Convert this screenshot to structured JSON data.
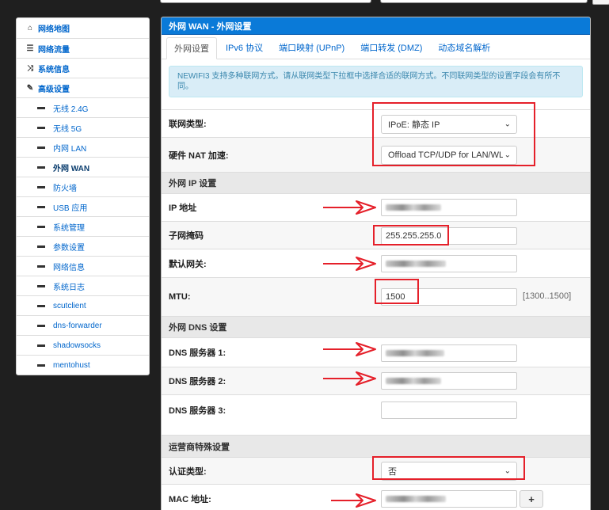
{
  "sidebar": {
    "items": [
      {
        "icon": "home-icon",
        "glyph": "⌂",
        "label": "网络地图",
        "type": "main"
      },
      {
        "icon": "list-icon",
        "glyph": "☰",
        "label": "网络流量",
        "type": "main"
      },
      {
        "icon": "shuffle-icon",
        "glyph": "⤨",
        "label": "系统信息",
        "type": "main"
      },
      {
        "icon": "wrench-icon",
        "glyph": "✎",
        "label": "高级设置",
        "type": "main"
      },
      {
        "label": "无线 2.4G",
        "type": "sub"
      },
      {
        "label": "无线 5G",
        "type": "sub"
      },
      {
        "label": "内网 LAN",
        "type": "sub"
      },
      {
        "label": "外网 WAN",
        "type": "sub",
        "active": true
      },
      {
        "label": "防火墙",
        "type": "sub"
      },
      {
        "label": "USB 应用",
        "type": "sub"
      },
      {
        "label": "系统管理",
        "type": "sub"
      },
      {
        "label": "参数设置",
        "type": "sub"
      },
      {
        "label": "网络信息",
        "type": "sub"
      },
      {
        "label": "系统日志",
        "type": "sub"
      },
      {
        "label": "scutclient",
        "type": "sub"
      },
      {
        "label": "dns-forwarder",
        "type": "sub"
      },
      {
        "label": "shadowsocks",
        "type": "sub"
      },
      {
        "label": "mentohust",
        "type": "sub"
      }
    ]
  },
  "panel": {
    "title": "外网 WAN - 外网设置",
    "tabs": [
      "外网设置",
      "IPv6 协议",
      "端口映射 (UPnP)",
      "端口转发 (DMZ)",
      "动态域名解析"
    ],
    "alert": "NEWIFI3 支持多种联网方式。请从联网类型下拉框中选择合适的联网方式。不同联网类型的设置字段会有所不同。"
  },
  "form": {
    "wan_type_label": "联网类型:",
    "wan_type_value": "IPoE: 静态 IP",
    "hw_nat_label": "硬件 NAT 加速:",
    "hw_nat_value": "Offload TCP/UDP for LAN/WLAN",
    "ip_section": "外网 IP 设置",
    "ip_label": "IP 地址",
    "netmask_label": "子网掩码",
    "netmask_value": "255.255.255.0",
    "gateway_label": "默认网关:",
    "mtu_label": "MTU:",
    "mtu_value": "1500",
    "mtu_hint": "[1300..1500]",
    "dns_section": "外网 DNS 设置",
    "dns1_label": "DNS 服务器 1:",
    "dns2_label": "DNS 服务器 2:",
    "dns3_label": "DNS 服务器 3:",
    "isp_section": "运营商特殊设置",
    "auth_label": "认证类型:",
    "auth_value": "否",
    "mac_label": "MAC 地址:",
    "mac_button": "+"
  },
  "colors": {
    "header_blue": "#0a7ad8",
    "annotation_red": "#e5202a",
    "alert_bg": "#d9edf7"
  }
}
